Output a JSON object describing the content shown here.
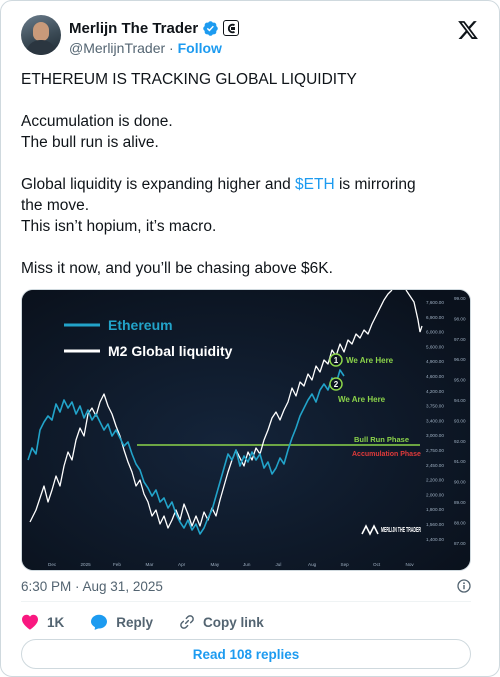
{
  "author": {
    "name": "Merlijn The Trader",
    "handle": "@MerlijnTrader",
    "separator": "·",
    "follow_label": "Follow"
  },
  "tweet": {
    "lines": [
      "ETHEREUM IS TRACKING GLOBAL LIQUIDITY",
      "Accumulation is done.",
      "The bull run is alive.",
      "Global liquidity is expanding higher and",
      "$ETH",
      "is mirroring",
      "the move.",
      "This isn’t hopium, it’s macro.",
      "Miss it now, and you’ll be chasing above $6K."
    ]
  },
  "chart_data": {
    "type": "line",
    "legend": [
      "Ethereum",
      "M2 Global liquidity"
    ],
    "series_colors": {
      "Ethereum": "#22a3c9",
      "M2 Global liquidity": "#ffffff"
    },
    "annotations": [
      "We Are Here",
      "We Are Here",
      "Bull Run Phase",
      "Accumulation Phase"
    ],
    "annotation_markers": [
      "1",
      "2"
    ],
    "x_ticks": [
      "Dec",
      "2025",
      "Feb",
      "Mar",
      "Apr",
      "May",
      "Jun",
      "Jul",
      "Aug",
      "Sep",
      "Oct",
      "Nov"
    ],
    "y_ticks_left": [
      "7,600.00",
      "6,900.00",
      "6,000.00",
      "5,600.00",
      "4,900.00",
      "4,600.00",
      "4,200.00",
      "3,750.00",
      "3,400.00",
      "3,000.00",
      "2,750.00",
      "2,450.00",
      "2,200.00",
      "2,000.00",
      "1,800.00",
      "1,560.00",
      "1,400.00"
    ],
    "y_ticks_right": [
      "99.00",
      "98.00",
      "97.00",
      "96.00",
      "95.00",
      "94.00",
      "93.00",
      "92.00",
      "91.00",
      "90.00",
      "89.00",
      "88.00",
      "87.00"
    ],
    "watermark": "MERLIJN THE TRADER",
    "colors": {
      "background": "#0c1421",
      "phase_line": "#8bd34a",
      "accumulation": "#e03a3a",
      "label_green": "#8bd34a"
    }
  },
  "meta": {
    "timestamp": "6:30 PM · Aug 31, 2025"
  },
  "actions": {
    "likes": "1K",
    "reply_label": "Reply",
    "copy_label": "Copy link"
  },
  "read_replies_label": "Read 108 replies"
}
